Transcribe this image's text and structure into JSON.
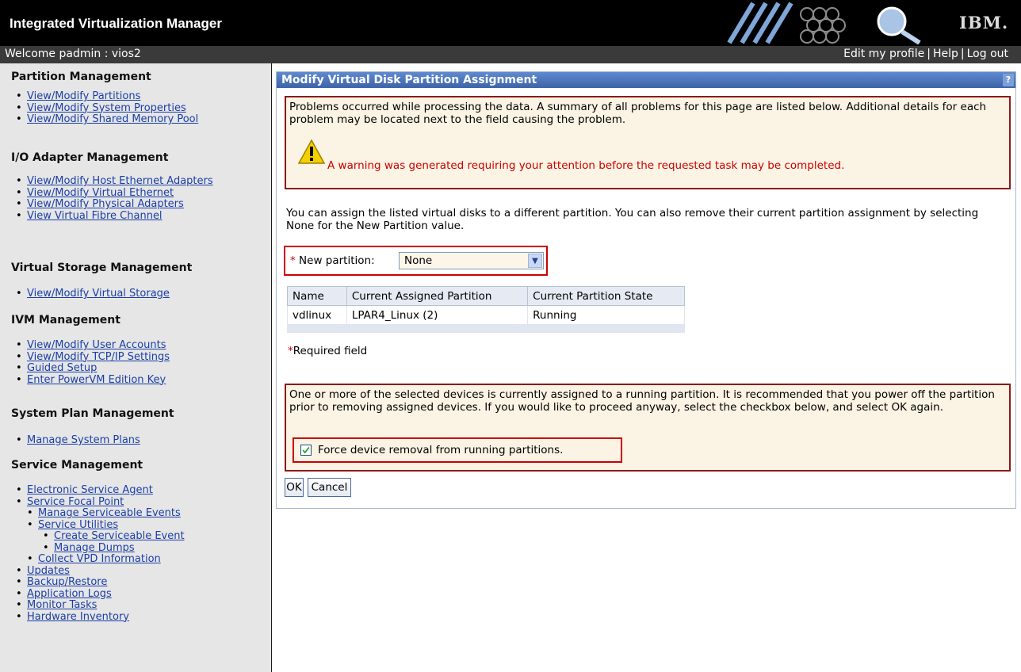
{
  "header": {
    "app_title": "Integrated Virtualization Manager",
    "brand": "IBM.",
    "welcome": "Welcome padmin : vios2",
    "links": [
      "Edit my profile",
      "Help",
      "Log out"
    ]
  },
  "sidebar": {
    "sections": [
      {
        "title": "Partition Management",
        "items": [
          "View/Modify Partitions",
          "View/Modify System Properties",
          "View/Modify Shared Memory Pool"
        ]
      },
      {
        "title": "I/O Adapter Management",
        "items": [
          "View/Modify Host Ethernet Adapters",
          "View/Modify Virtual Ethernet",
          "View/Modify Physical Adapters",
          "View Virtual Fibre Channel"
        ]
      },
      {
        "title": "Virtual Storage Management",
        "items": [
          "View/Modify Virtual Storage"
        ]
      },
      {
        "title": "IVM Management",
        "items": [
          "View/Modify User Accounts",
          "View/Modify TCP/IP Settings",
          "Guided Setup",
          "Enter PowerVM Edition Key"
        ]
      },
      {
        "title": "System Plan Management",
        "items": [
          "Manage System Plans"
        ]
      },
      {
        "title": "Service Management",
        "items": [
          "Electronic Service Agent",
          "Service Focal Point",
          "Manage Serviceable Events",
          "Service Utilities",
          "Create Serviceable Event",
          "Manage Dumps",
          "Collect VPD Information",
          "Updates",
          "Backup/Restore",
          "Application Logs",
          "Monitor Tasks",
          "Hardware Inventory"
        ]
      }
    ]
  },
  "panel": {
    "title": "Modify Virtual Disk Partition Assignment",
    "help_icon": "?",
    "error_summary": "Problems occurred while processing the data. A summary of all problems for this page are listed below. Additional details for each problem may be located next to the field causing the problem.",
    "warning_message": "A warning was generated requiring your attention before the requested task may be completed.",
    "info_text": "You can assign the listed virtual disks to a different partition. You can also remove their current partition assignment by selecting None for the New Partition value.",
    "new_partition_label": "New partition:",
    "new_partition_value": "None",
    "required_star": "*",
    "table": {
      "headers": [
        "Name",
        "Current Assigned Partition",
        "Current Partition State"
      ],
      "rows": [
        [
          "vdlinux",
          "LPAR4_Linux (2)",
          "Running"
        ]
      ]
    },
    "required_note": "Required field",
    "running_warning": "One or more of the selected devices is currently assigned to a running partition. It is recommended that you power off the partition prior to removing assigned devices. If you would like to proceed anyway, select the checkbox below, and select OK again.",
    "force_label": "Force device removal from running partitions.",
    "force_checked": true,
    "ok_label": "OK",
    "cancel_label": "Cancel"
  },
  "colors": {
    "title_bar": "#000000",
    "welcome_bar": "#3a3a3a",
    "panel_title": "#4a73bd",
    "error_border": "#8b1a1a",
    "warning_text": "#cc0000",
    "link": "#1a3ea8"
  }
}
